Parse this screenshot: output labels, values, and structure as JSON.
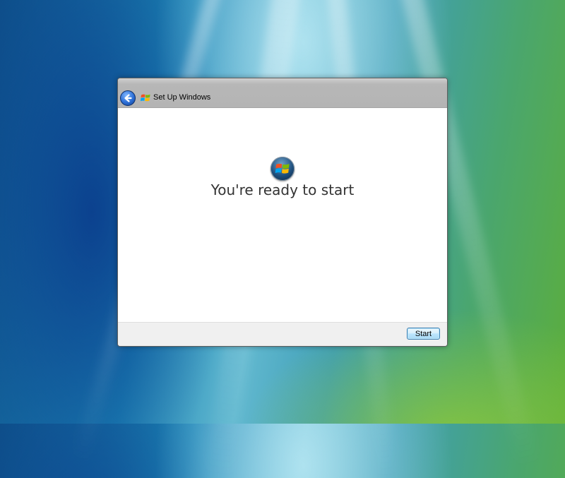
{
  "window": {
    "title": "Set Up Windows"
  },
  "main": {
    "heading": "You're ready to start"
  },
  "footer": {
    "start_label": "Start"
  },
  "icons": {
    "back": "back-arrow-icon",
    "window_title": "windows-flag-icon",
    "hero": "windows-orb-icon"
  },
  "colors": {
    "back_button": "#2d6fd6",
    "start_button_border": "#3c7fb1",
    "flag_red": "#f25022",
    "flag_green": "#7fba00",
    "flag_blue": "#00a4ef",
    "flag_yellow": "#ffb900"
  }
}
